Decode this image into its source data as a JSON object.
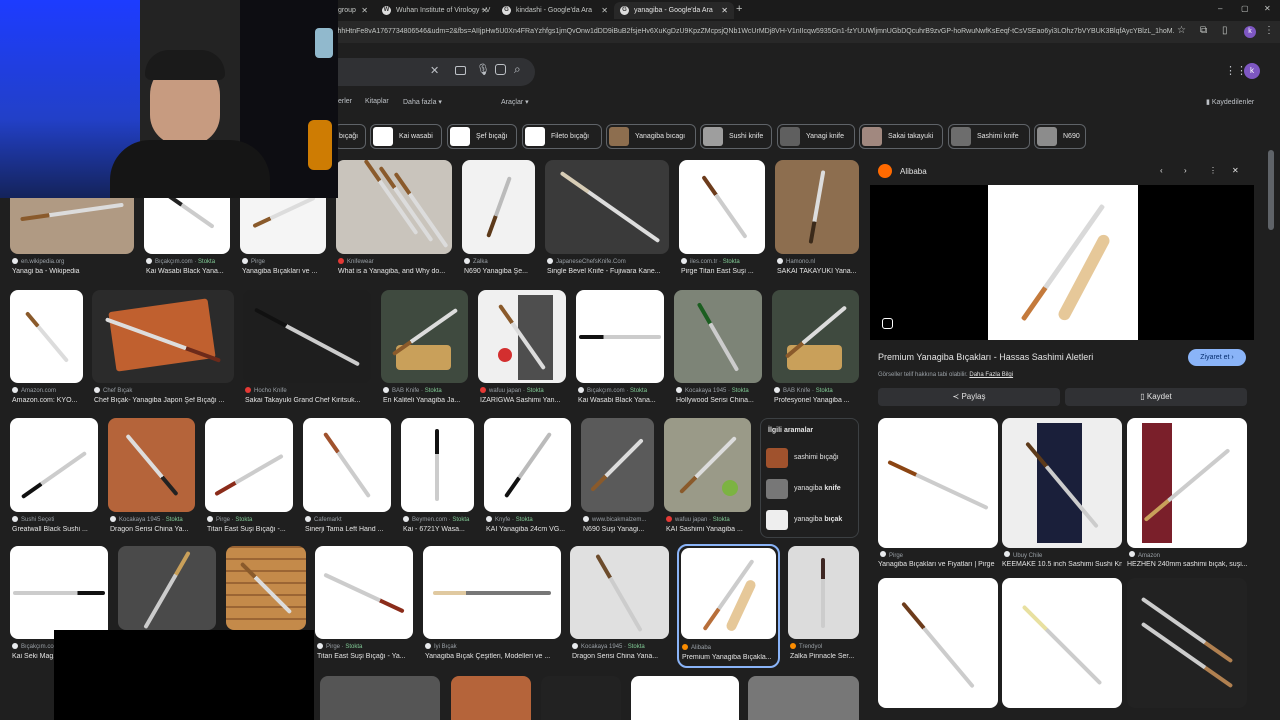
{
  "browser": {
    "tabs": [
      {
        "label": "group",
        "icon": "google-icon"
      },
      {
        "label": "Wuhan Institute of Virology - V",
        "icon": "wikipedia-icon"
      },
      {
        "label": "kindashi - Google'da Ara",
        "icon": "google-icon"
      },
      {
        "label": "yanagiba - Google'da Ara",
        "icon": "google-icon",
        "active": true
      }
    ],
    "url": "lehhHtnFe8vA1767734806546&udm=2&fbs=AIIjpHw5U0Xn4FRaYzhfgs1jmQvOnw1dDD9iBuB2fsjeHv6XuKgDzU9KpzZMcpsjQNb1WcUrMDj8VH-V1nIIcqw5935Gn1-fzYUUWljmnUGbDQcuhrB9zvGP-hoRwuNwfKsEeqf-tCsVSEao6yi3LOhz7bVYBUK3BlqfAycYBlzL_1hoM...",
    "profile_initial": "k",
    "window_controls": [
      "–",
      "▢",
      "✕"
    ]
  },
  "google": {
    "nav": {
      "more": "Daha fazla",
      "books": "Kitaplar",
      "tools": "Araçlar",
      "partial": "erler",
      "saved": "Kaydedilenler"
    },
    "chips": [
      "bıçağı",
      "Kai wasabi",
      "Şef bıçağı",
      "Fileto bıçağı",
      "Yanagiba bıcagı",
      "Sushi knife",
      "Yanagi knife",
      "Sakai takayuki",
      "Sashimi knife",
      "N690"
    ],
    "account_initial": "k"
  },
  "results": {
    "row1": [
      {
        "src": "en.wikipedia.org",
        "title": "Yanagi ba - Wikipedia"
      },
      {
        "src": "Bıçakçım.com",
        "stock": "Stokta",
        "title": "Kai Wasabi Black Yana..."
      },
      {
        "src": "Pirge",
        "title": "Yanagiba Bıçakları ve ..."
      },
      {
        "src": "Knifewear",
        "title": "What is a Yanagiba, and Why do..."
      },
      {
        "src": "Zalka",
        "title": "N690 Yanagiba Şe..."
      },
      {
        "src": "JapaneseChefsKnife.Com",
        "title": "Single Bevel Knife - Fujiwara Kane..."
      },
      {
        "src": "iles.com.tr",
        "stock": "Stokta",
        "title": "Pirge Titan East Suşi ..."
      },
      {
        "src": "Hamono.nl",
        "title": "SAKAI TAKAYUKI Yana..."
      }
    ],
    "row2": [
      {
        "src": "Amazon.com",
        "title": "Amazon.com: KYO..."
      },
      {
        "src": "Chef Bıçak",
        "title": "Chef Bıçak- Yanagiba Japon Şef Bıçağı ..."
      },
      {
        "src": "Hocho Knife",
        "title": "Sakai Takayuki Grand Chef Kiritsuk..."
      },
      {
        "src": "BAB Knife",
        "stock": "Stokta",
        "title": "En Kaliteli Yanagiba Ja..."
      },
      {
        "src": "wafuu japan",
        "stock": "Stokta",
        "title": "IZARIGWA Sashimi Yan..."
      },
      {
        "src": "Bıçakçım.com",
        "stock": "Stokta",
        "title": "Kai Wasabi Black Yana..."
      },
      {
        "src": "Kocakaya 1945",
        "stock": "Stokta",
        "title": "Hollywood Serisi China..."
      },
      {
        "src": "BAB Knife",
        "stock": "Stokta",
        "title": "Profesyonel Yanagiba ..."
      }
    ],
    "row3": [
      {
        "src": "Sushi Seçeti",
        "title": "Greatwall Black Sushi ..."
      },
      {
        "src": "Kocakaya 1945",
        "stock": "Stokta",
        "title": "Dragon Serisi China Ya..."
      },
      {
        "src": "Pirge",
        "stock": "Stokta",
        "title": "Titan East Suşi Bıçağı -..."
      },
      {
        "src": "Cafemarkt",
        "title": "Sinerji Tama Left Hand ..."
      },
      {
        "src": "Beymen.com",
        "stock": "Stokta",
        "title": "Kai - 6721Y Wasa..."
      },
      {
        "src": "Knyfe",
        "stock": "Stokta",
        "title": "KAI Yanagiba 24cm VG..."
      },
      {
        "src": "www.bicakmalzem...",
        "title": "N690 Suşi Yanagi..."
      },
      {
        "src": "wafuu japan",
        "stock": "Stokta",
        "title": "KAI Sashimi Yanagiba ..."
      }
    ],
    "row4": [
      {
        "src": "Bıçakçım.com",
        "title": "Kai Seki Mag..."
      },
      {
        "src": "Pirge",
        "stock": "Stokta",
        "title": "Titan East Suşi Bıçağı - Ya..."
      },
      {
        "src": "İyi Bıçak",
        "title": "Yanagiba Bıçak Çeşitleri, Modelleri ve ..."
      },
      {
        "src": "Kocakaya 1945",
        "stock": "Stokta",
        "title": "Dragon Serisi China Yana..."
      },
      {
        "src": "Alibaba",
        "title": "Premium Yanagiba Bıçakla..."
      },
      {
        "src": "Trendyol",
        "title": "Zalka Pinnacle Ser..."
      }
    ],
    "related": {
      "heading": "İlgili aramalar",
      "items": [
        {
          "text": "sashimi bıçağı",
          "bold": ""
        },
        {
          "text": "yanagiba ",
          "bold": "knife"
        },
        {
          "text": "yanagiba ",
          "bold": "bıçak"
        }
      ]
    },
    "stock_label": "Stokta"
  },
  "panel": {
    "source": "Alibaba",
    "title": "Premium Yanagiba Bıçakları - Hassas Sashimi Aletleri",
    "visit": "Ziyaret et",
    "copyright_note": "Görseller telif hakkına tabi olabilir.",
    "more_info": "Daha Fazla Bilgi",
    "share": "Paylaş",
    "save": "Kaydet",
    "similar": [
      {
        "src": "Pirge",
        "title": "Yanagiba Bıçakları ve Fiyatları | Pirge"
      },
      {
        "src": "Ubuy Chile",
        "title": "KEEMAKE 10.5 inch Sashimi Sushi Knife ..."
      },
      {
        "src": "Amazon",
        "title": "HEZHEN 240mm sashimi bıçak, suşi..."
      }
    ]
  }
}
